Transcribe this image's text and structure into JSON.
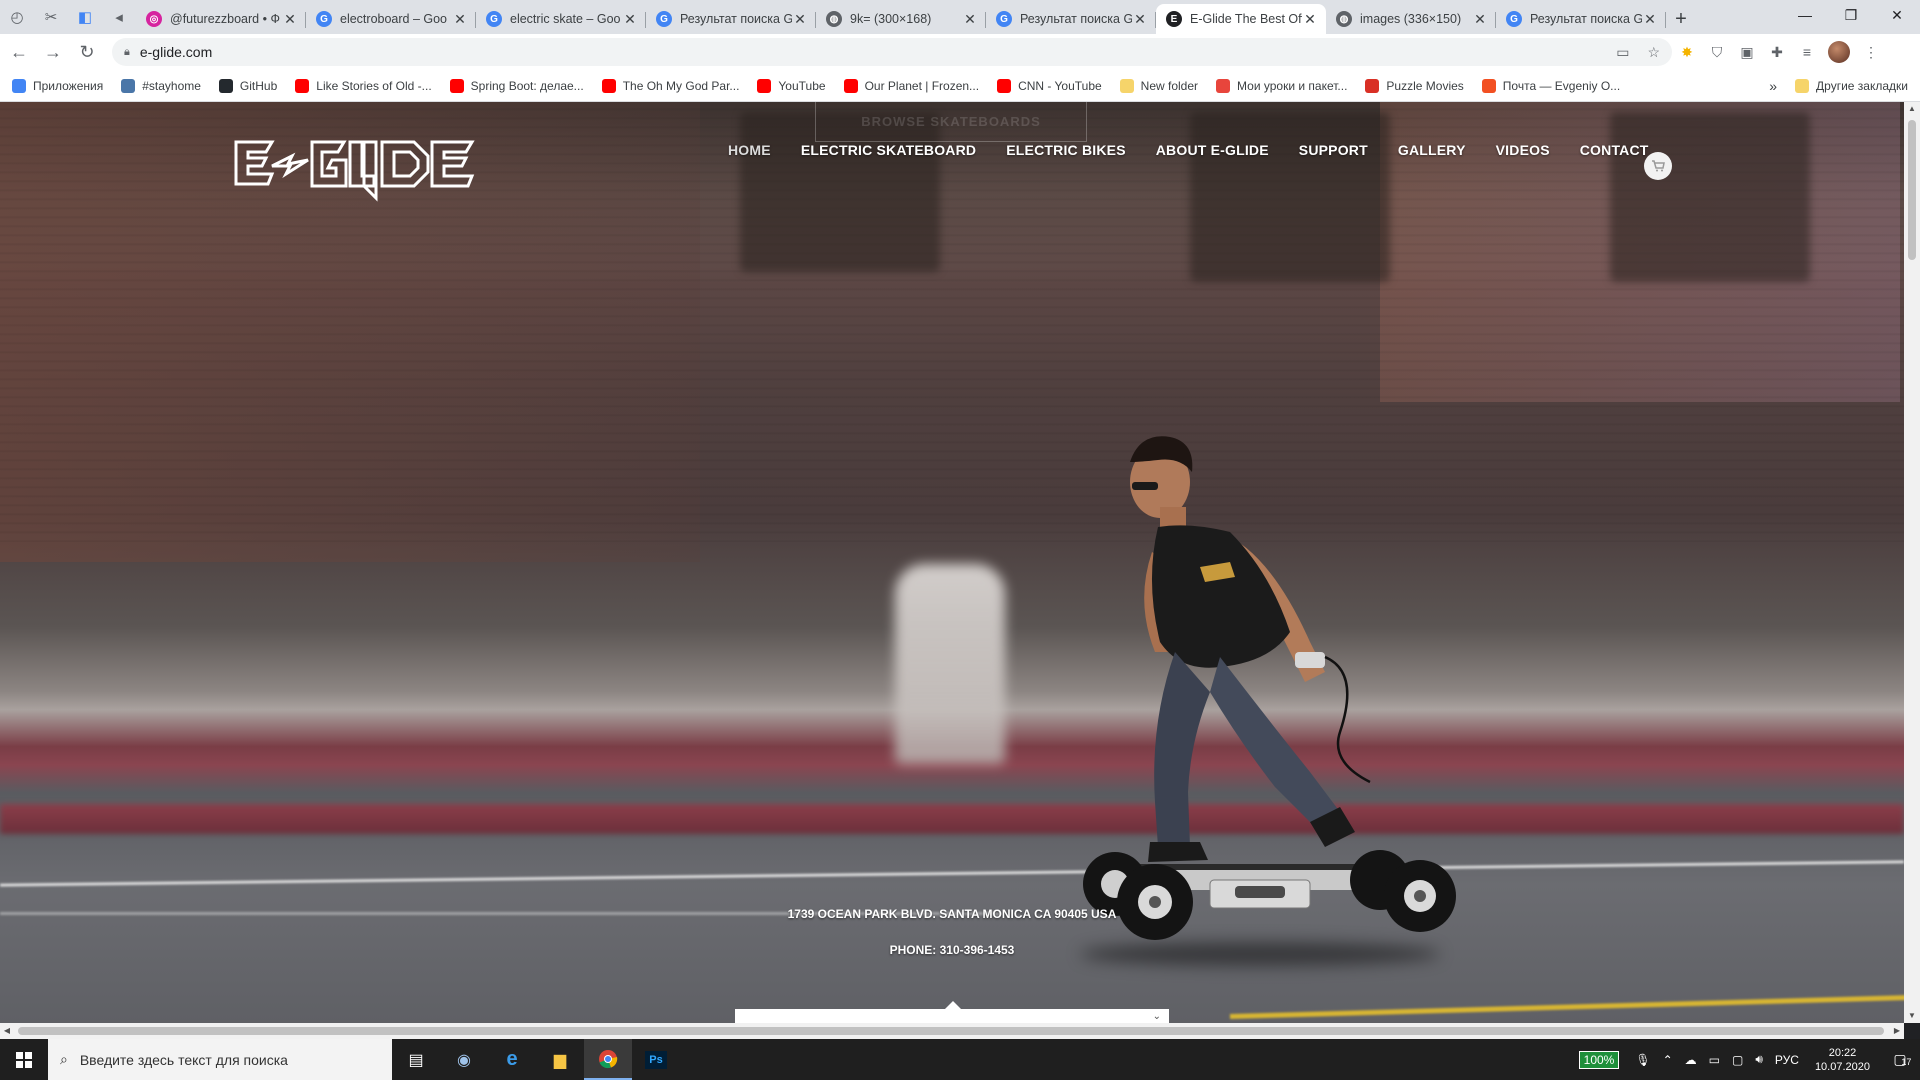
{
  "browser": {
    "tabs": [
      {
        "title": "@futurezzboard • Ф",
        "icon": "instagram-icon",
        "color": "#d6249f",
        "glyph": "◎"
      },
      {
        "title": "electroboard – Goo",
        "icon": "google-icon",
        "color": "#4285f4",
        "glyph": "G"
      },
      {
        "title": "electric skate – Goo",
        "icon": "google-icon",
        "color": "#4285f4",
        "glyph": "G"
      },
      {
        "title": "Результат поиска G",
        "icon": "google-icon",
        "color": "#4285f4",
        "glyph": "G"
      },
      {
        "title": "9k= (300×168)",
        "icon": "globe-icon",
        "color": "#5f6368",
        "glyph": "◍"
      },
      {
        "title": "Результат поиска G",
        "icon": "google-icon",
        "color": "#4285f4",
        "glyph": "G"
      },
      {
        "title": "E-Glide The Best Off",
        "icon": "eglide-icon",
        "color": "#202124",
        "glyph": "E"
      },
      {
        "title": "images (336×150)",
        "icon": "globe-icon",
        "color": "#5f6368",
        "glyph": "◍"
      },
      {
        "title": "Результат поиска G",
        "icon": "google-icon",
        "color": "#4285f4",
        "glyph": "G"
      }
    ],
    "active_tab": 6,
    "url": "e-glide.com",
    "bookmarks": [
      {
        "label": "Приложения",
        "icon": "apps-icon",
        "color": "#4285f4"
      },
      {
        "label": "#stayhome",
        "icon": "vk-icon",
        "color": "#4a76a8"
      },
      {
        "label": "GitHub",
        "icon": "github-icon",
        "color": "#24292e"
      },
      {
        "label": "Like Stories of Old -...",
        "icon": "youtube-icon",
        "color": "#ff0000"
      },
      {
        "label": "Spring Boot: делае...",
        "icon": "youtube-icon",
        "color": "#ff0000"
      },
      {
        "label": "The Oh My God Par...",
        "icon": "youtube-icon",
        "color": "#ff0000"
      },
      {
        "label": "YouTube",
        "icon": "youtube-icon",
        "color": "#ff0000"
      },
      {
        "label": "Our Planet | Frozen...",
        "icon": "youtube-icon",
        "color": "#ff0000"
      },
      {
        "label": "CNN - YouTube",
        "icon": "youtube-icon",
        "color": "#ff0000"
      },
      {
        "label": "New folder",
        "icon": "folder-icon",
        "color": "#f6d46a"
      },
      {
        "label": "Мои уроки и пакет...",
        "icon": "lessons-icon",
        "color": "#e8453c"
      },
      {
        "label": "Puzzle Movies",
        "icon": "puzzle-movies-icon",
        "color": "#d93025"
      },
      {
        "label": "Почта — Evgeniy O...",
        "icon": "microsoft-icon",
        "color": "#f25022"
      }
    ],
    "bookmarks_more": "»",
    "other_bookmarks": "Другие закладки"
  },
  "site": {
    "browse_button": "BROWSE SKATEBOARDS",
    "nav": [
      "HOME",
      "ELECTRIC SKATEBOARD",
      "ELECTRIC BIKES",
      "ABOUT E-GLIDE",
      "SUPPORT",
      "GALLERY",
      "VIDEOS",
      "CONTACT"
    ],
    "address": "1739 OCEAN PARK BLVD. SANTA MONICA CA 90405 USA",
    "phone": "PHONE: 310-396-1453"
  },
  "taskbar": {
    "search_placeholder": "Введите здесь текст для поиска",
    "battery": "100%",
    "language": "РУС",
    "time": "20:22",
    "date": "10.07.2020",
    "notifications": "17"
  }
}
